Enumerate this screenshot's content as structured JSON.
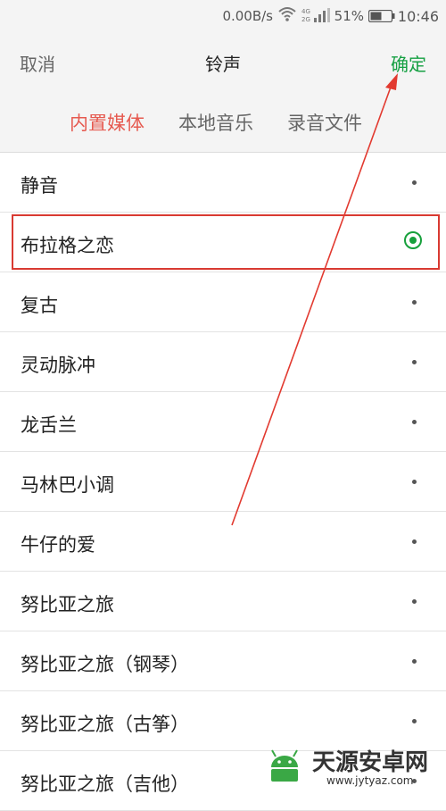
{
  "status_bar": {
    "net_speed": "0.00B/s",
    "signal_labels": [
      "4G",
      "2G"
    ],
    "battery_percent": "51%",
    "time": "10:46"
  },
  "header": {
    "cancel_label": "取消",
    "title": "铃声",
    "confirm_label": "确定",
    "tabs": [
      {
        "label": "内置媒体",
        "active": true
      },
      {
        "label": "本地音乐",
        "active": false
      },
      {
        "label": "录音文件",
        "active": false
      }
    ]
  },
  "ringtones": [
    {
      "name": "静音",
      "selected": false
    },
    {
      "name": "布拉格之恋",
      "selected": true
    },
    {
      "name": "复古",
      "selected": false
    },
    {
      "name": "灵动脉冲",
      "selected": false
    },
    {
      "name": "龙舌兰",
      "selected": false
    },
    {
      "name": "马林巴小调",
      "selected": false
    },
    {
      "name": "牛仔的爱",
      "selected": false
    },
    {
      "name": "努比亚之旅",
      "selected": false
    },
    {
      "name": "努比亚之旅（钢琴）",
      "selected": false
    },
    {
      "name": "努比亚之旅（古筝）",
      "selected": false
    },
    {
      "name": "努比亚之旅（吉他）",
      "selected": false
    }
  ],
  "colors": {
    "accent_green": "#16a043",
    "active_tab": "#e65a50",
    "highlight_red": "#d93a32"
  },
  "watermark": {
    "title": "天源安卓网",
    "url": "www.jytyaz.com"
  }
}
